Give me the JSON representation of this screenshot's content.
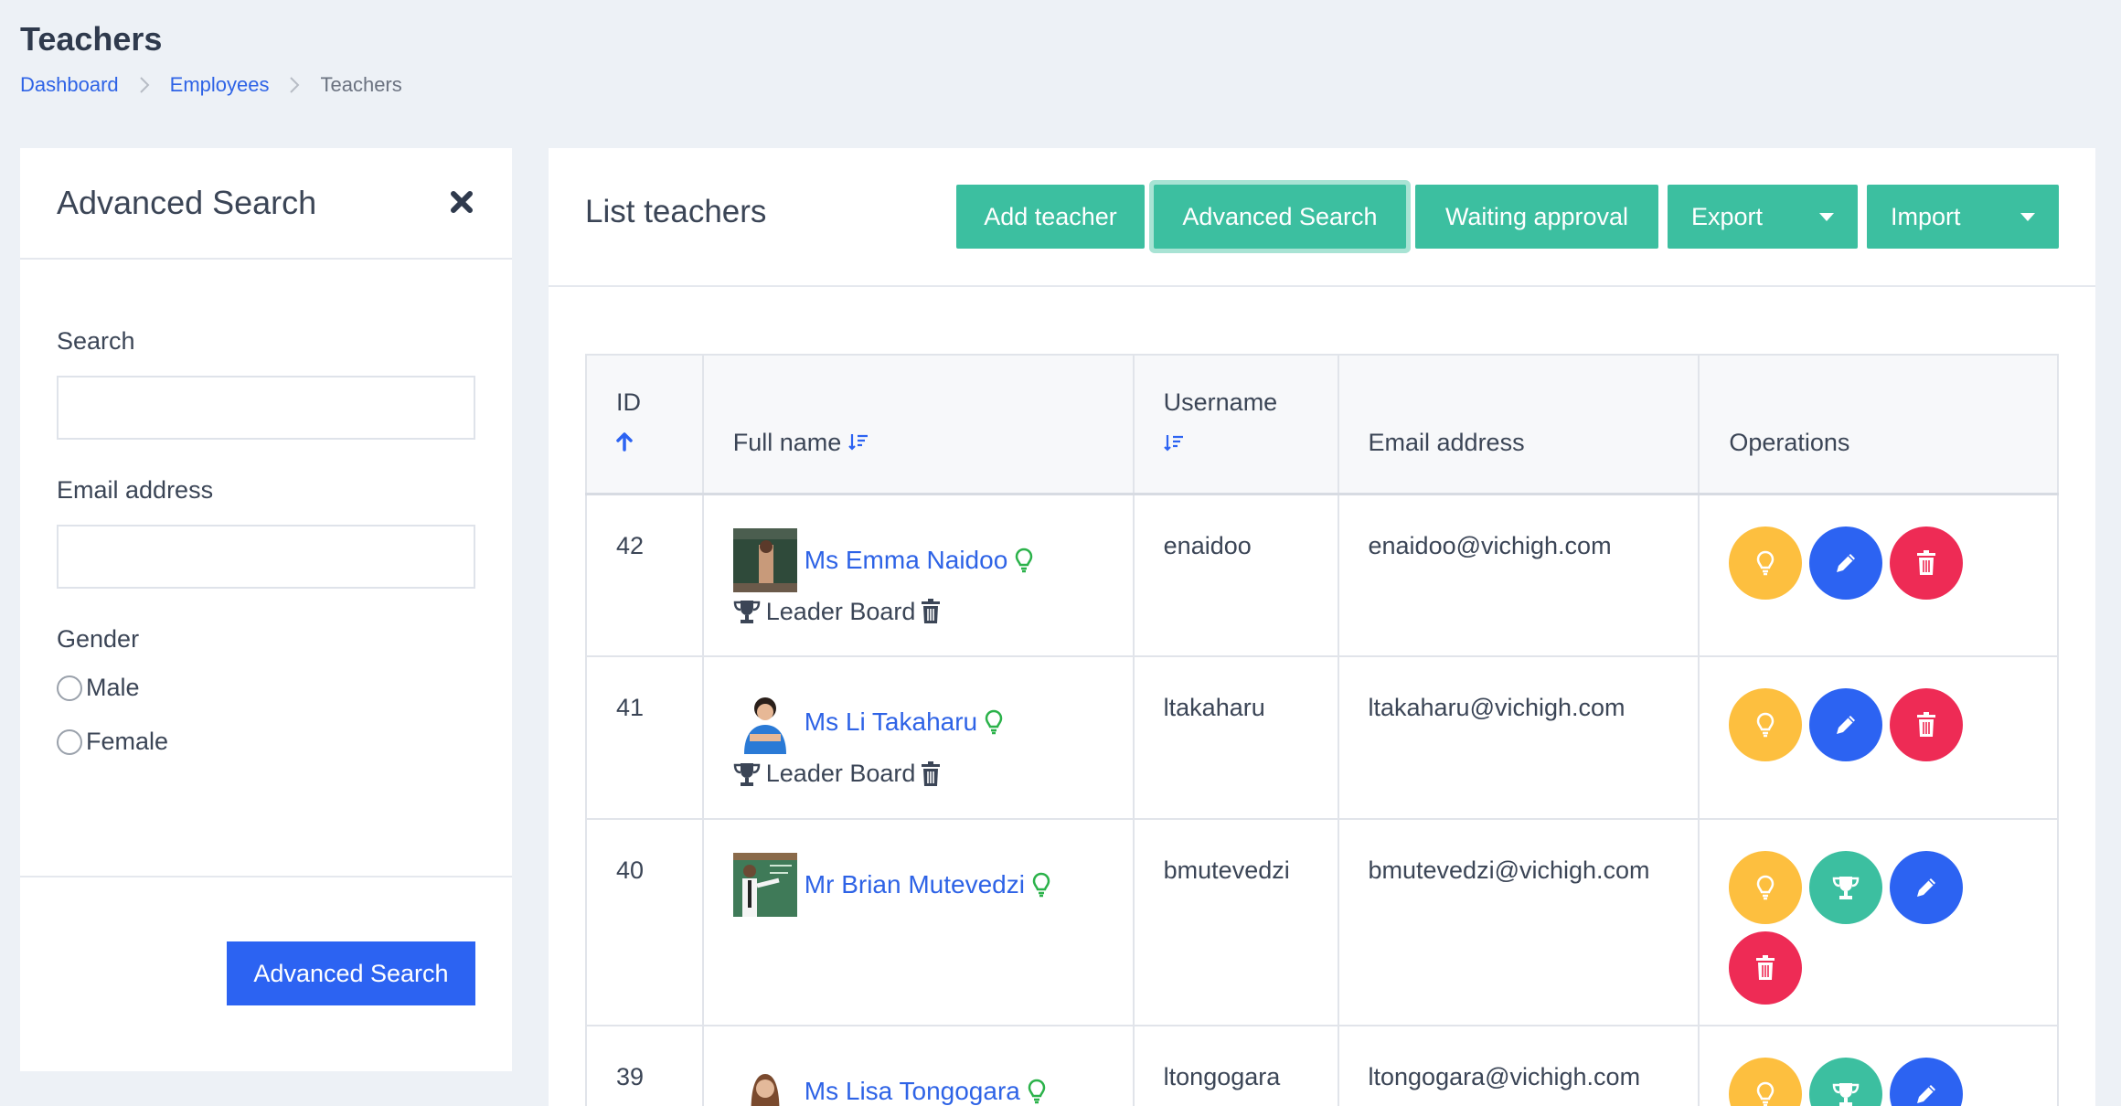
{
  "page": {
    "title": "Teachers",
    "breadcrumb": [
      "Dashboard",
      "Employees",
      "Teachers"
    ]
  },
  "advanced_search": {
    "title": "Advanced Search",
    "search_label": "Search",
    "search_value": "",
    "email_label": "Email address",
    "email_value": "",
    "gender_label": "Gender",
    "gender_options": [
      "Male",
      "Female"
    ],
    "submit_label": "Advanced Search"
  },
  "list": {
    "title": "List teachers",
    "toolbar": {
      "add": "Add teacher",
      "advanced": "Advanced Search",
      "waiting": "Waiting approval",
      "export": "Export",
      "import": "Import"
    },
    "columns": {
      "id": "ID",
      "full_name": "Full name",
      "username": "Username",
      "email": "Email address",
      "operations": "Operations"
    },
    "rows": [
      {
        "id": "42",
        "name": "Ms Emma Naidoo",
        "username": "enaidoo",
        "email": "enaidoo@vichigh.com",
        "leader_board": "Leader Board",
        "ops": [
          "idea",
          "edit",
          "delete"
        ]
      },
      {
        "id": "41",
        "name": "Ms Li Takaharu",
        "username": "ltakaharu",
        "email": "ltakaharu@vichigh.com",
        "leader_board": "Leader Board",
        "ops": [
          "idea",
          "edit",
          "delete"
        ]
      },
      {
        "id": "40",
        "name": "Mr Brian Mutevedzi",
        "username": "bmutevedzi",
        "email": "bmutevedzi@vichigh.com",
        "leader_board": "",
        "ops": [
          "idea",
          "trophy",
          "edit",
          "delete"
        ]
      },
      {
        "id": "39",
        "name": "Ms Lisa Tongogara",
        "username": "ltongogara",
        "email": "ltongogara@vichigh.com",
        "leader_board": "",
        "ops": [
          "idea",
          "trophy",
          "edit"
        ]
      }
    ]
  },
  "colors": {
    "primary": "#2c63f2",
    "teal": "#3cbfa0",
    "yellow": "#fdbf3f",
    "red": "#ee2b55",
    "background": "#edf1f6"
  }
}
